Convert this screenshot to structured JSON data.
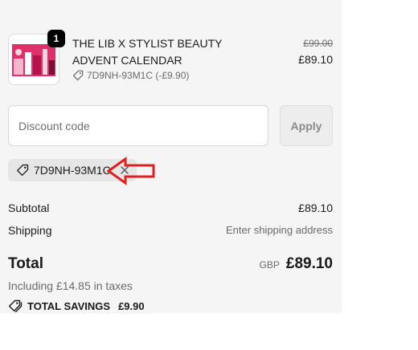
{
  "product": {
    "quantity": "1",
    "name": "THE LIB X STYLIST BEAUTY ADVENT CALENDAR",
    "discount_line": "7D9NH-93M1C (-£9.90)",
    "compare_price": "£99.00",
    "price": "£89.10"
  },
  "discount": {
    "placeholder": "Discount code",
    "apply_label": "Apply",
    "applied_code": "7D9NH-93M1C"
  },
  "summary": {
    "subtotal_label": "Subtotal",
    "subtotal_value": "£89.10",
    "shipping_label": "Shipping",
    "shipping_value": "Enter shipping address",
    "total_label": "Total",
    "currency": "GBP",
    "total_value": "£89.10",
    "taxes": "Including £14.85 in taxes",
    "savings_label": "TOTAL SAVINGS",
    "savings_value": "£9.90"
  },
  "colors": {
    "panel_bg": "#f5f5f5",
    "arrow": "#e02020",
    "badge": "#000000"
  }
}
